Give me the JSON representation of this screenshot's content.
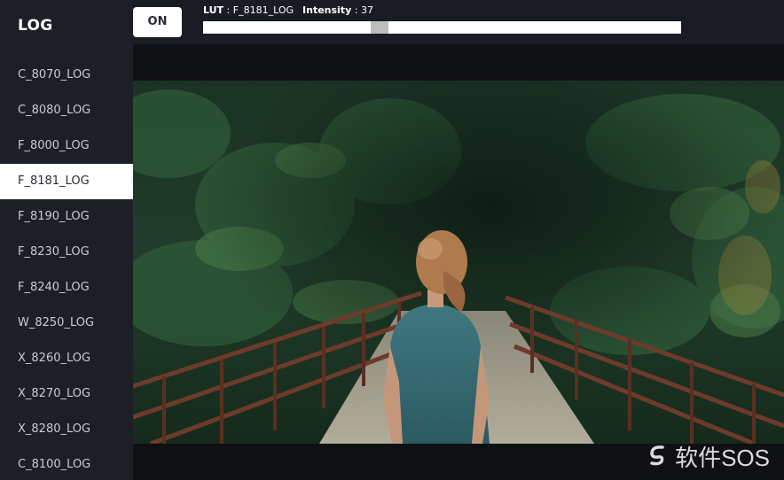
{
  "sidebar": {
    "title": "LOG",
    "items": [
      {
        "label": "C_8070_LOG"
      },
      {
        "label": "C_8080_LOG"
      },
      {
        "label": "F_8000_LOG"
      },
      {
        "label": "F_8181_LOG",
        "selected": true
      },
      {
        "label": "F_8190_LOG"
      },
      {
        "label": "F_8230_LOG"
      },
      {
        "label": "F_8240_LOG"
      },
      {
        "label": "W_8250_LOG"
      },
      {
        "label": "X_8260_LOG"
      },
      {
        "label": "X_8270_LOG"
      },
      {
        "label": "X_8280_LOG"
      },
      {
        "label": "C_8100_LOG"
      }
    ]
  },
  "toolbar": {
    "toggle_label": "ON",
    "lut_key": "LUT",
    "lut_value": "F_8181_LOG",
    "intensity_key": "Intensity",
    "intensity_value": "37",
    "intensity_fraction": 0.37
  },
  "watermark": {
    "text": "软件SOS",
    "icon": "swirl-logo-icon"
  },
  "colors": {
    "sidebar_bg": "#1d1f27",
    "topbar_bg": "#1a1c24",
    "selected_bg": "#ffffff",
    "slider_track": "#ffffff",
    "slider_thumb": "#bdbdbd"
  }
}
